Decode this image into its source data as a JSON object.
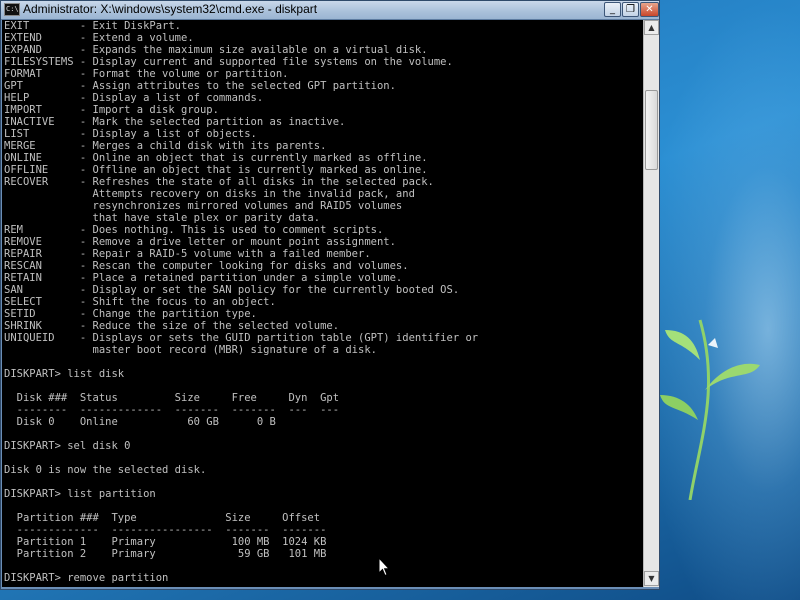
{
  "window": {
    "title": "Administrator: X:\\windows\\system32\\cmd.exe - diskpart",
    "icon_text": "C:\\",
    "minimize_label": "_",
    "restore_label": "❐",
    "close_label": "✕"
  },
  "console": {
    "lines": [
      "EXIT        - Exit DiskPart.",
      "EXTEND      - Extend a volume.",
      "EXPAND      - Expands the maximum size available on a virtual disk.",
      "FILESYSTEMS - Display current and supported file systems on the volume.",
      "FORMAT      - Format the volume or partition.",
      "GPT         - Assign attributes to the selected GPT partition.",
      "HELP        - Display a list of commands.",
      "IMPORT      - Import a disk group.",
      "INACTIVE    - Mark the selected partition as inactive.",
      "LIST        - Display a list of objects.",
      "MERGE       - Merges a child disk with its parents.",
      "ONLINE      - Online an object that is currently marked as offline.",
      "OFFLINE     - Offline an object that is currently marked as online.",
      "RECOVER     - Refreshes the state of all disks in the selected pack.",
      "              Attempts recovery on disks in the invalid pack, and",
      "              resynchronizes mirrored volumes and RAID5 volumes",
      "              that have stale plex or parity data.",
      "REM         - Does nothing. This is used to comment scripts.",
      "REMOVE      - Remove a drive letter or mount point assignment.",
      "REPAIR      - Repair a RAID-5 volume with a failed member.",
      "RESCAN      - Rescan the computer looking for disks and volumes.",
      "RETAIN      - Place a retained partition under a simple volume.",
      "SAN         - Display or set the SAN policy for the currently booted OS.",
      "SELECT      - Shift the focus to an object.",
      "SETID       - Change the partition type.",
      "SHRINK      - Reduce the size of the selected volume.",
      "UNIQUEID    - Displays or sets the GUID partition table (GPT) identifier or",
      "              master boot record (MBR) signature of a disk.",
      "",
      "DISKPART> list disk",
      "",
      "  Disk ###  Status         Size     Free     Dyn  Gpt",
      "  --------  -------------  -------  -------  ---  ---",
      "  Disk 0    Online           60 GB      0 B",
      "",
      "DISKPART> sel disk 0",
      "",
      "Disk 0 is now the selected disk.",
      "",
      "DISKPART> list partition",
      "",
      "  Partition ###  Type              Size     Offset",
      "  -------------  ----------------  -------  -------",
      "  Partition 1    Primary            100 MB  1024 KB",
      "  Partition 2    Primary             59 GB   101 MB",
      "",
      "DISKPART> remove partition"
    ]
  },
  "scrollbar": {
    "up_arrow": "▲",
    "down_arrow": "▼"
  }
}
